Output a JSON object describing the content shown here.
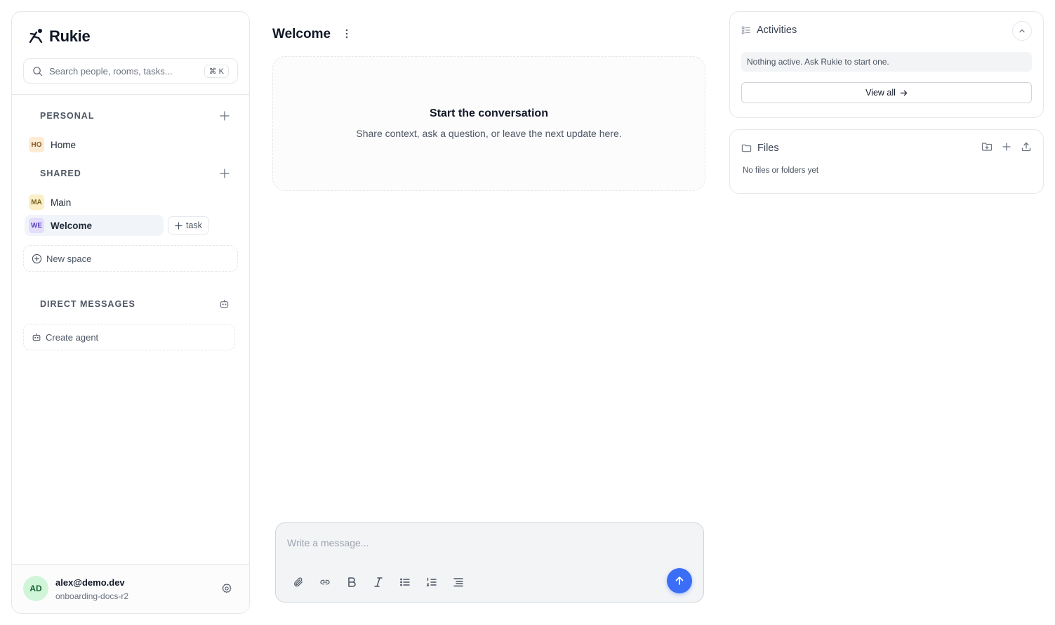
{
  "brand": {
    "name": "Rukie"
  },
  "search": {
    "placeholder": "Search people, rooms, tasks...",
    "shortcut": "⌘ K"
  },
  "sections": {
    "personal": "PERSONAL",
    "shared": "SHARED",
    "direct_messages": "DIRECT MESSAGES"
  },
  "spaces": {
    "personal": [
      {
        "badge": "HO",
        "label": "Home"
      }
    ],
    "shared": [
      {
        "badge": "MA",
        "label": "Main"
      },
      {
        "badge": "WE",
        "label": "Welcome",
        "active": true
      }
    ]
  },
  "task_button": "task",
  "new_space": "New space",
  "create_agent": "Create agent",
  "user": {
    "initials": "AD",
    "email": "alex@demo.dev",
    "workspace": "onboarding-docs-r2"
  },
  "main": {
    "title": "Welcome",
    "empty_title": "Start the conversation",
    "empty_subtitle": "Share context, ask a question, or leave the next update here."
  },
  "composer": {
    "placeholder": "Write a message..."
  },
  "activities": {
    "title": "Activities",
    "empty": "Nothing active. Ask Rukie to start one.",
    "view_all": "View all"
  },
  "files": {
    "title": "Files",
    "empty": "No files or folders yet"
  },
  "colors": {
    "accent": "#3b6ef6",
    "border": "#e5e7eb"
  }
}
